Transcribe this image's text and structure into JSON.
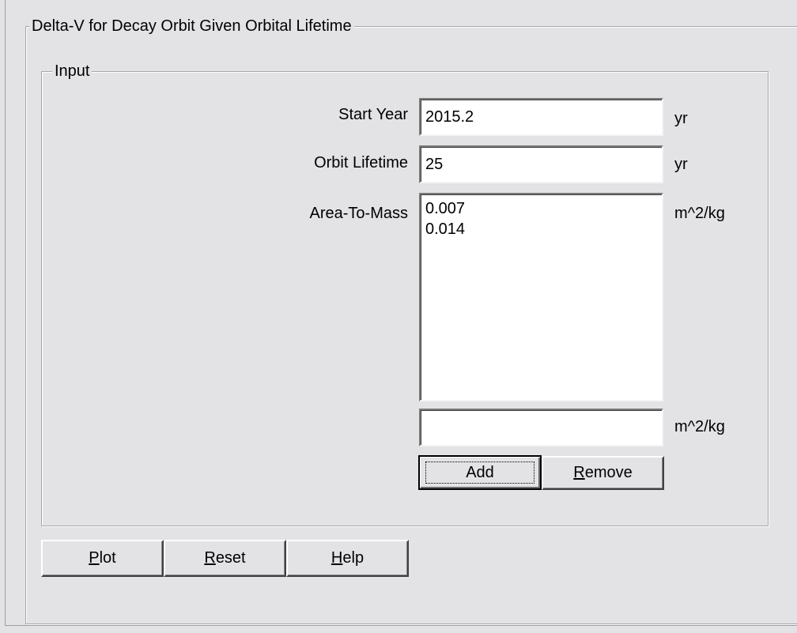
{
  "panel": {
    "title": "Delta-V for Decay Orbit Given Orbital Lifetime"
  },
  "input_group": {
    "title": "Input",
    "start_year": {
      "label": "Start Year",
      "value": "2015.2",
      "unit": "yr"
    },
    "orbit_lifetime": {
      "label": "Orbit Lifetime",
      "value": "25",
      "unit": "yr"
    },
    "area_to_mass": {
      "label": "Area-To-Mass",
      "unit": "m^2/kg",
      "items": [
        "0.007",
        "0.014"
      ],
      "new_value": "",
      "new_unit": "m^2/kg"
    },
    "add_button": {
      "label": "Add",
      "mnemonic": ""
    },
    "remove_button": {
      "label_mnemonic": "R",
      "label_rest": "emove"
    }
  },
  "actions": {
    "plot": {
      "mnemonic": "P",
      "rest": "lot"
    },
    "reset": {
      "mnemonic": "R",
      "rest": "eset"
    },
    "help": {
      "mnemonic": "H",
      "rest": "elp"
    }
  }
}
